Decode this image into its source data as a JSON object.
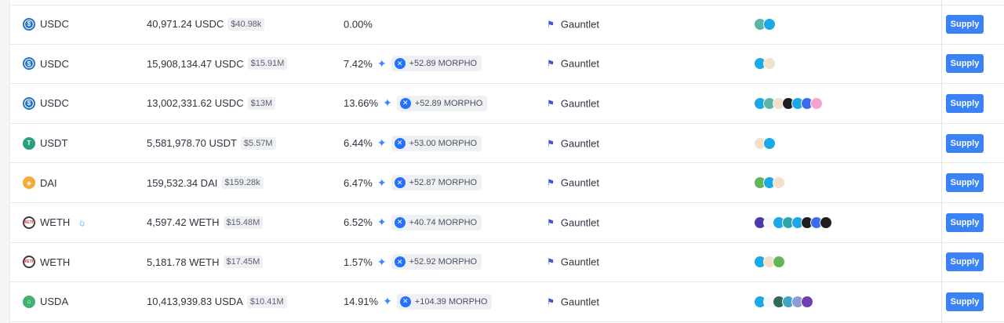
{
  "columns": {
    "supply_label": "Supply"
  },
  "rows": [
    {
      "asset": "USDC",
      "coin": "usdc",
      "total": "40,971.24 USDC",
      "usd": "$40.98k",
      "apy": "0.00%",
      "reward": "",
      "curator": "Gauntlet",
      "collateral_colors": [
        "#5ab7a6",
        "#1ba8e6"
      ]
    },
    {
      "asset": "USDC",
      "coin": "usdc",
      "total": "15,908,134.47 USDC",
      "usd": "$15.91M",
      "apy": "7.42%",
      "reward": "+52.89 MORPHO",
      "curator": "Gauntlet",
      "collateral_colors": [
        "#1ba8e6",
        "#f2e0c8"
      ]
    },
    {
      "asset": "USDC",
      "coin": "usdc",
      "total": "13,002,331.62 USDC",
      "usd": "$13M",
      "apy": "13.66%",
      "reward": "+52.89 MORPHO",
      "curator": "Gauntlet",
      "collateral_colors": [
        "#1ba8e6",
        "#5ab7a6",
        "#f2e0c8",
        "#202020",
        "#1ba8e6",
        "#3b6cf0",
        "#f5a3d0"
      ]
    },
    {
      "asset": "USDT",
      "coin": "usdt",
      "total": "5,581,978.70 USDT",
      "usd": "$5.57M",
      "apy": "6.44%",
      "reward": "+53.00 MORPHO",
      "curator": "Gauntlet",
      "collateral_colors": [
        "#f2e0c8",
        "#1ba8e6"
      ]
    },
    {
      "asset": "DAI",
      "coin": "dai",
      "total": "159,532.34 DAI",
      "usd": "$159.28k",
      "apy": "6.47%",
      "reward": "+52.87 MORPHO",
      "curator": "Gauntlet",
      "collateral_colors": [
        "#62b657",
        "#1ba8e6",
        "#f2e0c8"
      ]
    },
    {
      "asset": "WETH",
      "coin": "weth",
      "total": "4,597.42 WETH",
      "usd": "$15.48M",
      "apy": "6.52%",
      "reward": "+40.74 MORPHO",
      "curator": "Gauntlet",
      "extra_icon": true,
      "collateral_colors": [
        "#4c3aa8",
        "#f6f6f6",
        "#1ba8e6",
        "#2fa5a8",
        "#1ba8e6",
        "#202020",
        "#3b6cf0",
        "#202020"
      ]
    },
    {
      "asset": "WETH",
      "coin": "weth",
      "total": "5,181.78 WETH",
      "usd": "$17.45M",
      "apy": "1.57%",
      "reward": "+52.92 MORPHO",
      "curator": "Gauntlet",
      "collateral_colors": [
        "#1ba8e6",
        "#f2e0c8",
        "#62b657"
      ]
    },
    {
      "asset": "USDA",
      "coin": "usda",
      "total": "10,413,939.83 USDA",
      "usd": "$10.41M",
      "apy": "14.91%",
      "reward": "+104.39 MORPHO",
      "curator": "Gauntlet",
      "collateral_colors": [
        "#1ba8e6",
        "#f6f6f6",
        "#2b6a57",
        "#3fa7c2",
        "#8a9bd6",
        "#6e3fb0"
      ]
    }
  ]
}
